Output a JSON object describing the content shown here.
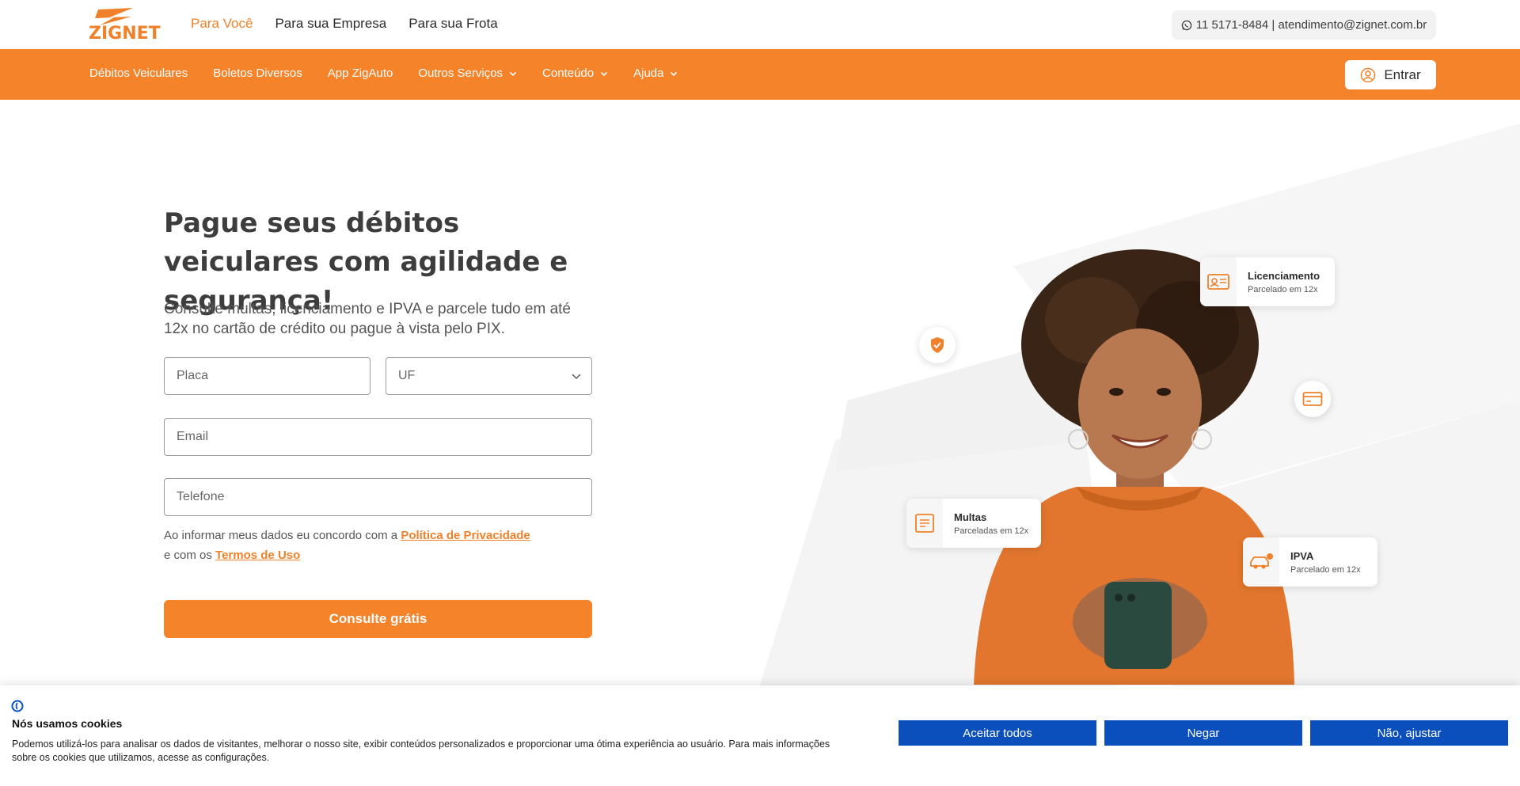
{
  "brand": {
    "name": "ZIGNET",
    "accent": "#f5832a",
    "cookie_button_color": "#0b4fbd"
  },
  "top_nav": {
    "items": [
      {
        "label": "Para Você",
        "active": true
      },
      {
        "label": "Para sua Empresa",
        "active": false
      },
      {
        "label": "Para sua Frota",
        "active": false
      }
    ],
    "contact": "11 5171-8484 | atendimento@zignet.com.br"
  },
  "main_nav": {
    "items": [
      {
        "label": "Débitos Veiculares"
      },
      {
        "label": "Boletos Diversos"
      },
      {
        "label": "App ZigAuto"
      },
      {
        "label": "Outros Serviços"
      },
      {
        "label": "Conteúdo"
      },
      {
        "label": "Ajuda"
      }
    ],
    "login_label": "Entrar"
  },
  "hero": {
    "title": "Pague seus débitos veiculares com agilidade e segurança!",
    "subtitle": "Consulte multas, licenciamento e IPVA e parcele tudo em até 12x no cartão de crédito ou pague à vista pelo PIX."
  },
  "form": {
    "placa_placeholder": "Placa",
    "uf_selected": "UF",
    "email_placeholder": "Email",
    "telefone_placeholder": "Telefone",
    "consent_prefix": "Ao informar meus dados eu concordo com a ",
    "privacy_link": "Política de Privacidade",
    "consent_middle": "e com os ",
    "terms_link": "Termos de Uso",
    "submit_label": "Consulte grátis"
  },
  "cards": {
    "licenciamento": {
      "title": "Licenciamento",
      "subtitle": "Parcelado em 12x"
    },
    "multas": {
      "title": "Multas",
      "subtitle": "Parceladas em 12x"
    },
    "ipva": {
      "title": "IPVA",
      "subtitle": "Parcelado em 12x"
    }
  },
  "cookie": {
    "title": "Nós usamos cookies",
    "text": "Podemos utilizá-los para analisar os dados de visitantes, melhorar o nosso site, exibir conteúdos personalizados e proporcionar uma ótima experiência ao usuário. Para mais informações sobre os cookies que utilizamos, acesse as configurações.",
    "accept_label": "Aceitar todos",
    "deny_label": "Negar",
    "adjust_label": "Não, ajustar"
  }
}
